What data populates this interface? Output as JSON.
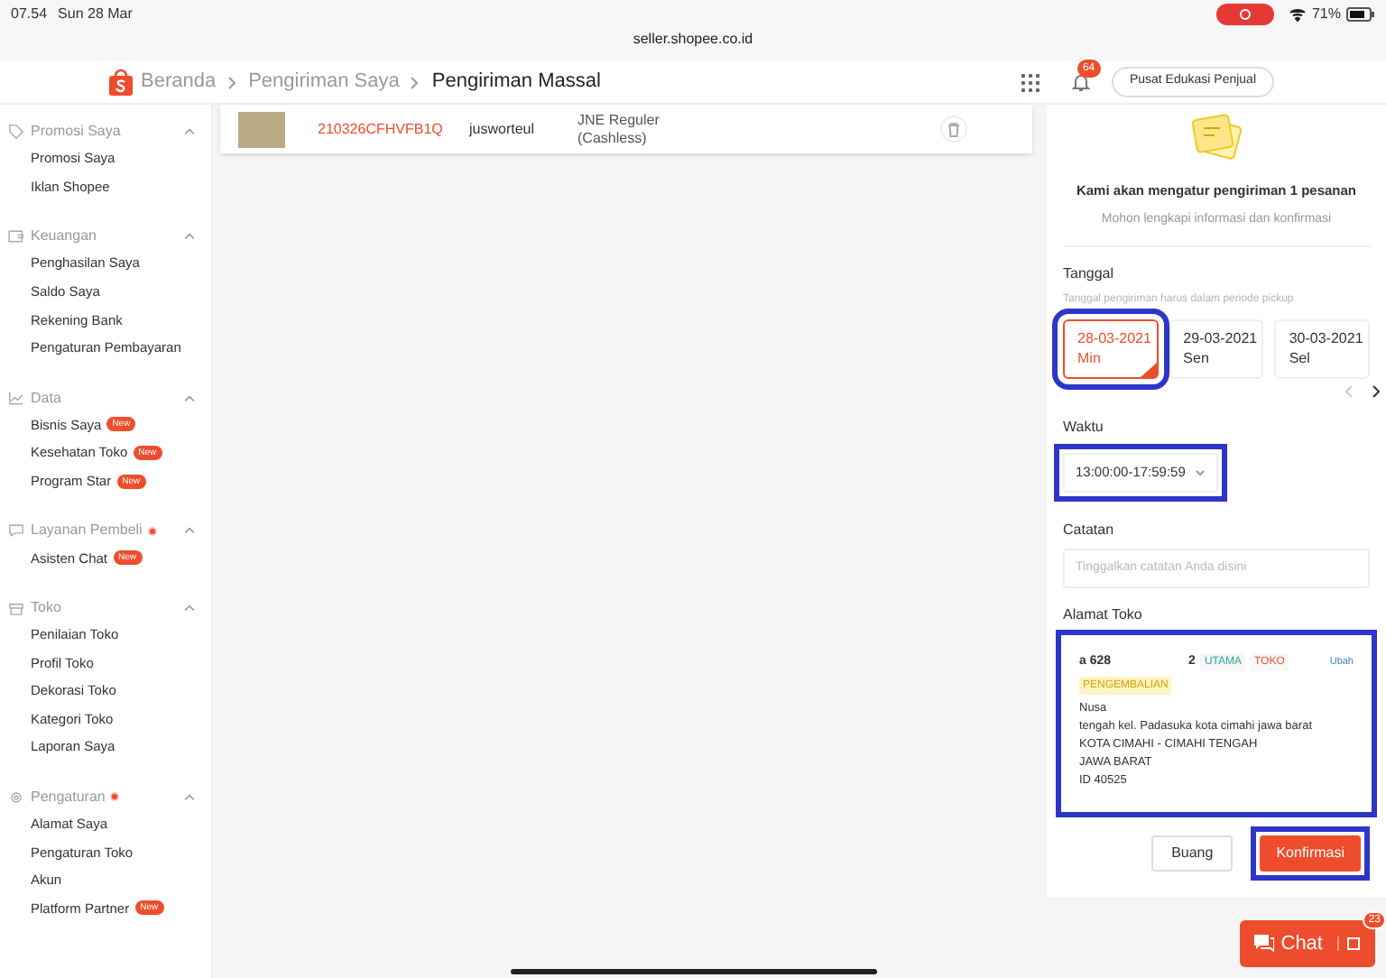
{
  "status_bar": {
    "time": "07.54",
    "date": "Sun 28 Mar",
    "battery": "71%",
    "url": "seller.shopee.co.id"
  },
  "breadcrumb": [
    {
      "label": "Beranda",
      "current": false
    },
    {
      "label": "Pengiriman Saya",
      "current": false
    },
    {
      "label": "Pengiriman Massal",
      "current": true
    }
  ],
  "header": {
    "notification_count": "64",
    "edu_button": "Pusat Edukasi Penjual"
  },
  "sidebar": [
    {
      "title": "Promosi Saya",
      "dot": false,
      "items": [
        {
          "label": "Promosi Saya"
        },
        {
          "label": "Iklan Shopee"
        }
      ]
    },
    {
      "title": "Keuangan",
      "dot": false,
      "items": [
        {
          "label": "Penghasilan Saya"
        },
        {
          "label": "Saldo Saya"
        },
        {
          "label": "Rekening Bank"
        },
        {
          "label": "Pengaturan Pembayaran"
        }
      ]
    },
    {
      "title": "Data",
      "dot": false,
      "items": [
        {
          "label": "Bisnis Saya",
          "badge": "New"
        },
        {
          "label": "Kesehatan Toko",
          "badge": "New"
        },
        {
          "label": "Program Star",
          "badge": "New"
        }
      ]
    },
    {
      "title": "Layanan Pembeli",
      "dot": true,
      "items": [
        {
          "label": "Asisten Chat",
          "badge": "New"
        }
      ]
    },
    {
      "title": "Toko",
      "dot": false,
      "items": [
        {
          "label": "Penilaian Toko"
        },
        {
          "label": "Profil Toko"
        },
        {
          "label": "Dekorasi Toko"
        },
        {
          "label": "Kategori Toko"
        },
        {
          "label": "Laporan Saya"
        }
      ]
    },
    {
      "title": "Pengaturan",
      "dot": true,
      "items": [
        {
          "label": "Alamat Saya"
        },
        {
          "label": "Pengaturan Toko"
        },
        {
          "label": "Akun"
        },
        {
          "label": "Platform Partner",
          "badge": "New"
        }
      ]
    }
  ],
  "order_row": {
    "order_id": "210326CFHVFB1Q",
    "buyer": "jusworteul",
    "courier": "JNE Reguler (Cashless)"
  },
  "panel": {
    "heading": "Kami akan mengatur pengiriman 1 pesanan",
    "subheading": "Mohon lengkapi informasi dan konfirmasi",
    "date_label": "Tanggal",
    "date_hint": "Tanggal pengiriman harus dalam periode pickup",
    "dates": [
      {
        "date": "28-03-2021",
        "day": "Min",
        "selected": true
      },
      {
        "date": "29-03-2021",
        "day": "Sen",
        "selected": false
      },
      {
        "date": "30-03-2021",
        "day": "Sel",
        "selected": false
      }
    ],
    "time_label": "Waktu",
    "time_value": "13:00:00-17:59:59",
    "note_label": "Catatan",
    "note_placeholder": "Tinggalkan catatan Anda disini",
    "address_label": "Alamat Toko",
    "address": {
      "name": "a 628",
      "phone_end": "2",
      "tags": [
        {
          "label": "UTAMA",
          "color": "#26aa99"
        },
        {
          "label": "TOKO",
          "color": "#ee4d2d"
        },
        {
          "label": "PENGEMBALIAN",
          "color": "#d9a400"
        }
      ],
      "edit": "Ubah",
      "lines": [
        "Nusa",
        "tengah kel. Padasuka kota cimahi jawa barat",
        "KOTA CIMAHI - CIMAHI TENGAH",
        "JAWA BARAT",
        "ID 40525"
      ]
    },
    "discard_button": "Buang",
    "confirm_button": "Konfirmasi"
  },
  "chat": {
    "label": "Chat",
    "count": "23"
  }
}
